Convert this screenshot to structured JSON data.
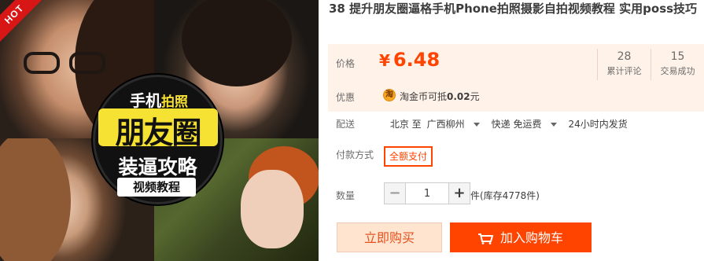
{
  "gallery": {
    "hot_badge": "HOT",
    "badge": {
      "top_left": "手机",
      "top_right": "拍照",
      "main": "朋友圈",
      "sub": "装逼攻略",
      "tag": "视频教程"
    }
  },
  "product": {
    "title": "38 提升朋友圈逼格手机Phone拍照摄影自拍视频教程 实用poss技巧"
  },
  "price": {
    "label": "价格",
    "currency": "¥",
    "amount": "6.48"
  },
  "stats": [
    {
      "num": "28",
      "label": "累计评论"
    },
    {
      "num": "15",
      "label": "交易成功"
    }
  ],
  "promo": {
    "label": "优惠",
    "coin_icon": "淘",
    "text_prefix": "淘金币可抵",
    "amount": "0.02",
    "unit": "元"
  },
  "shipping": {
    "label": "配送",
    "from": "北京 至",
    "to": "广西柳州",
    "method": "快递 免运费",
    "time": "24小时内发货"
  },
  "payment": {
    "label": "付款方式",
    "option": "全额支付"
  },
  "quantity": {
    "label": "数量",
    "minus": "−",
    "value": "1",
    "plus": "+",
    "stock": "件(库存4778件)"
  },
  "actions": {
    "buy_now": "立即购买",
    "add_to_cart": "加入购物车"
  },
  "colors": {
    "accent": "#ff4400",
    "price_bg": "#fff2e8"
  }
}
